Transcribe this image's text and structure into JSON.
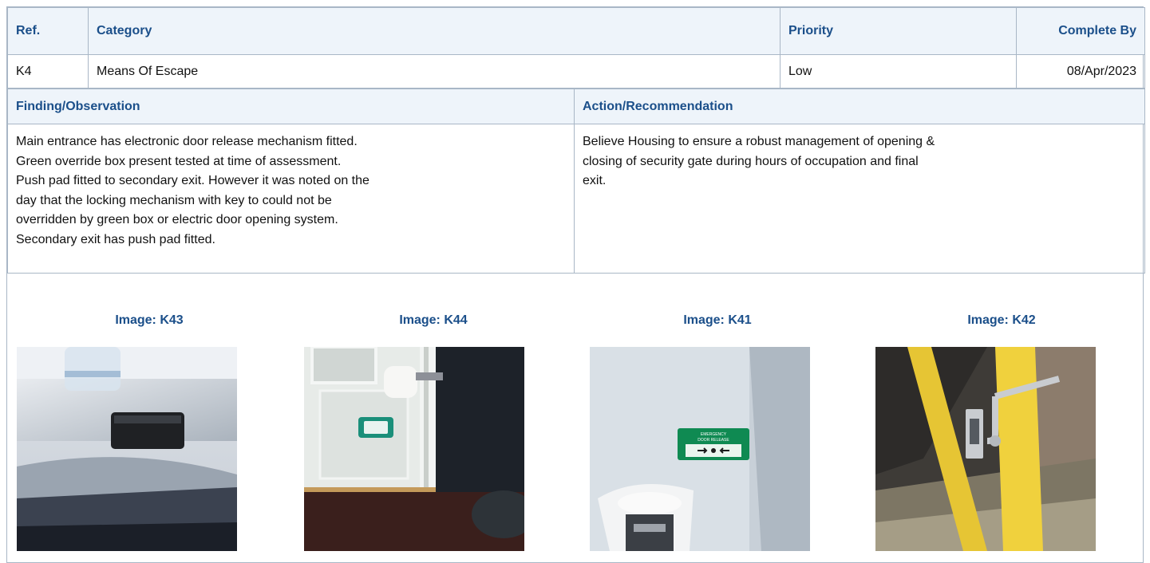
{
  "header": {
    "ref_label": "Ref.",
    "category_label": "Category",
    "priority_label": "Priority",
    "complete_by_label": "Complete By"
  },
  "row": {
    "ref": "K4",
    "category": "Means Of Escape",
    "priority": "Low",
    "complete_by": "08/Apr/2023"
  },
  "finding": {
    "label": "Finding/Observation",
    "lines": [
      "Main entrance has electronic door release mechanism fitted.",
      "Green override box present tested at time of assessment.",
      "Push pad fitted to secondary exit. However it was noted on the",
      "day that the locking mechanism with key to could not be",
      "overridden by green box or electric door opening system.",
      "Secondary exit has push pad fitted."
    ]
  },
  "action": {
    "label": "Action/Recommendation",
    "lines": [
      "Believe Housing to ensure a robust management of opening &",
      "closing of security gate during hours of occupation and final",
      "exit."
    ]
  },
  "images": [
    {
      "title": "Image: K43"
    },
    {
      "title": "Image: K44"
    },
    {
      "title": "Image: K41",
      "sign_text_1": "EMERGENCY",
      "sign_text_2": "DOOR RELEASE"
    },
    {
      "title": "Image: K42"
    }
  ]
}
